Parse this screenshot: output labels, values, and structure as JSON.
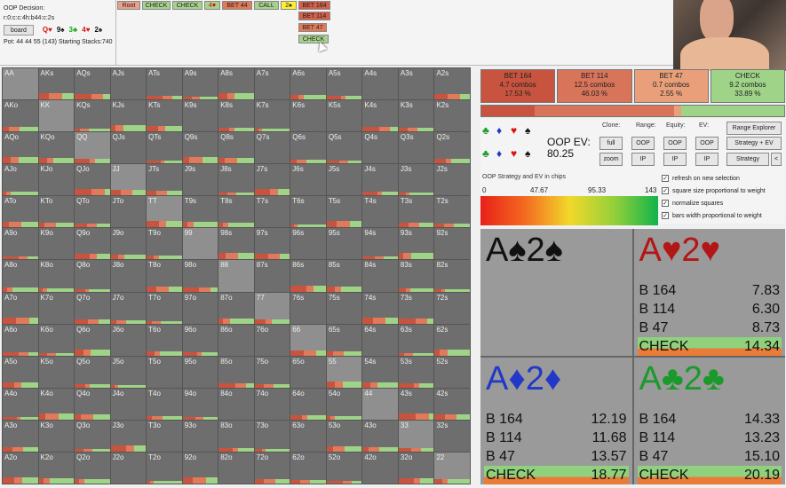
{
  "header": {
    "decision_label": "OOP Decision:",
    "path": "r:0:c:c:4h:b44:c:2s",
    "board_button": "board",
    "board_cards": [
      {
        "text": "Q♥",
        "color": "#d11"
      },
      {
        "text": "9♠",
        "color": "#111"
      },
      {
        "text": "3♣",
        "color": "#1a1"
      },
      {
        "text": "4♥",
        "color": "#d11"
      },
      {
        "text": "2♠",
        "color": "#111"
      }
    ],
    "pot_info": "Pot: 44 44 55 (143) Starting Stacks:740"
  },
  "tree": {
    "row1": [
      "Root",
      "CHECK",
      "CHECK",
      "4♥",
      "BET 44",
      "CALL",
      "2♠"
    ],
    "row1_extra": "BET 164",
    "row2": "BET 114",
    "row3": "BET 47",
    "row4": "CHECK"
  },
  "matrix": {
    "hands": [
      [
        "AA",
        "AKs",
        "AQs",
        "AJs",
        "ATs",
        "A9s",
        "A8s",
        "A7s",
        "A6s",
        "A5s",
        "A4s",
        "A3s",
        "A2s"
      ],
      [
        "AKo",
        "KK",
        "KQs",
        "KJs",
        "KTs",
        "K9s",
        "K8s",
        "K7s",
        "K6s",
        "K5s",
        "K4s",
        "K3s",
        "K2s"
      ],
      [
        "AQo",
        "KQo",
        "QQ",
        "QJs",
        "QTs",
        "Q9s",
        "Q8s",
        "Q7s",
        "Q6s",
        "Q5s",
        "Q4s",
        "Q3s",
        "Q2s"
      ],
      [
        "AJo",
        "KJo",
        "QJo",
        "JJ",
        "JTs",
        "J9s",
        "J8s",
        "J7s",
        "J6s",
        "J5s",
        "J4s",
        "J3s",
        "J2s"
      ],
      [
        "ATo",
        "KTo",
        "QTo",
        "JTo",
        "TT",
        "T9s",
        "T8s",
        "T7s",
        "T6s",
        "T5s",
        "T4s",
        "T3s",
        "T2s"
      ],
      [
        "A9o",
        "K9o",
        "Q9o",
        "J9o",
        "T9o",
        "99",
        "98s",
        "97s",
        "96s",
        "95s",
        "94s",
        "93s",
        "92s"
      ],
      [
        "A8o",
        "K8o",
        "Q8o",
        "J8o",
        "T8o",
        "98o",
        "88",
        "87s",
        "86s",
        "85s",
        "84s",
        "83s",
        "82s"
      ],
      [
        "A7o",
        "K7o",
        "Q7o",
        "J7o",
        "T7o",
        "97o",
        "87o",
        "77",
        "76s",
        "75s",
        "74s",
        "73s",
        "72s"
      ],
      [
        "A6o",
        "K6o",
        "Q6o",
        "J6o",
        "T6o",
        "96o",
        "86o",
        "76o",
        "66",
        "65s",
        "64s",
        "63s",
        "62s"
      ],
      [
        "A5o",
        "K5o",
        "Q5o",
        "J5o",
        "T5o",
        "95o",
        "85o",
        "75o",
        "65o",
        "55",
        "54s",
        "53s",
        "52s"
      ],
      [
        "A4o",
        "K4o",
        "Q4o",
        "J4o",
        "T4o",
        "94o",
        "84o",
        "74o",
        "64o",
        "54o",
        "44",
        "43s",
        "42s"
      ],
      [
        "A3o",
        "K3o",
        "Q3o",
        "J3o",
        "T3o",
        "93o",
        "83o",
        "73o",
        "63o",
        "53o",
        "43o",
        "33",
        "32s"
      ],
      [
        "A2o",
        "K2o",
        "Q2o",
        "J2o",
        "T2o",
        "92o",
        "82o",
        "72o",
        "62o",
        "52o",
        "42o",
        "32o",
        "22"
      ]
    ]
  },
  "summary": [
    {
      "label": "BET 164",
      "combos": "4.7 combos",
      "pct": "17.53 %",
      "color": "#c8543f"
    },
    {
      "label": "BET 114",
      "combos": "12.5 combos",
      "pct": "46.03 %",
      "color": "#d8745a"
    },
    {
      "label": "BET 47",
      "combos": "0.7 combos",
      "pct": "2.55 %",
      "color": "#e9a07a"
    },
    {
      "label": "CHECK",
      "combos": "9.2 combos",
      "pct": "33.89 %",
      "color": "#9fd388"
    }
  ],
  "stackbar": [
    {
      "frac": 0.1753,
      "color": "#c8543f"
    },
    {
      "frac": 0.4603,
      "color": "#d8745a"
    },
    {
      "frac": 0.0255,
      "color": "#e9a07a"
    },
    {
      "frac": 0.3389,
      "color": "#9fd388"
    }
  ],
  "panel": {
    "ev_label": "OOP EV:",
    "ev_value": "80.25",
    "clone_label": "Clone:",
    "range_label": "Range:",
    "equity_label": "Equity:",
    "ev_col_label": "EV:",
    "btn_full": "full",
    "btn_zoom": "zoom",
    "btn_oop1": "OOP",
    "btn_ip1": "IP",
    "btn_oop2": "OOP",
    "btn_ip2": "IP",
    "btn_oop3": "OOP",
    "btn_ip3": "IP",
    "btn_range_explorer": "Range Explorer",
    "btn_strategy_ev": "Strategy + EV",
    "btn_strategy": "Strategy",
    "btn_back": "<",
    "strategy_chips_label": "OOP Strategy and EV in chips",
    "ticks": [
      "0",
      "47.67",
      "95.33",
      "143"
    ],
    "checkboxes": [
      {
        "label": "refresh on new selection",
        "checked": "✓"
      },
      {
        "label": "square size proportional to weight",
        "checked": "✓"
      },
      {
        "label": "normalize squares",
        "checked": "✓"
      },
      {
        "label": "bars width proportional to weight",
        "checked": "✓"
      }
    ],
    "suits": [
      {
        "sym": "♣",
        "color": "#1a9a2a"
      },
      {
        "sym": "♦",
        "color": "#2238c8"
      },
      {
        "sym": "♥",
        "color": "#d11"
      },
      {
        "sym": "♠",
        "color": "#111"
      },
      {
        "sym": "♣",
        "color": "#1a9a2a"
      },
      {
        "sym": "♦",
        "color": "#2238c8"
      },
      {
        "sym": "♥",
        "color": "#d11"
      },
      {
        "sym": "♠",
        "color": "#111"
      }
    ]
  },
  "combos": [
    {
      "title": "A♠2♠",
      "color": "#111",
      "rows": []
    },
    {
      "title": "A♥2♥",
      "color": "#b31616",
      "rows": [
        [
          "B 164",
          "7.83"
        ],
        [
          "B 114",
          "6.30"
        ],
        [
          "B 47",
          "8.73"
        ],
        [
          "CHECK",
          "14.34"
        ]
      ]
    },
    {
      "title": "A♦2♦",
      "color": "#2238c8",
      "rows": [
        [
          "B 164",
          "12.19"
        ],
        [
          "B 114",
          "11.68"
        ],
        [
          "B 47",
          "13.57"
        ],
        [
          "CHECK",
          "18.77"
        ]
      ]
    },
    {
      "title": "A♣2♣",
      "color": "#1a9a2a",
      "rows": [
        [
          "B 164",
          "14.33"
        ],
        [
          "B 114",
          "13.23"
        ],
        [
          "B 47",
          "15.10"
        ],
        [
          "CHECK",
          "20.19"
        ]
      ]
    }
  ]
}
